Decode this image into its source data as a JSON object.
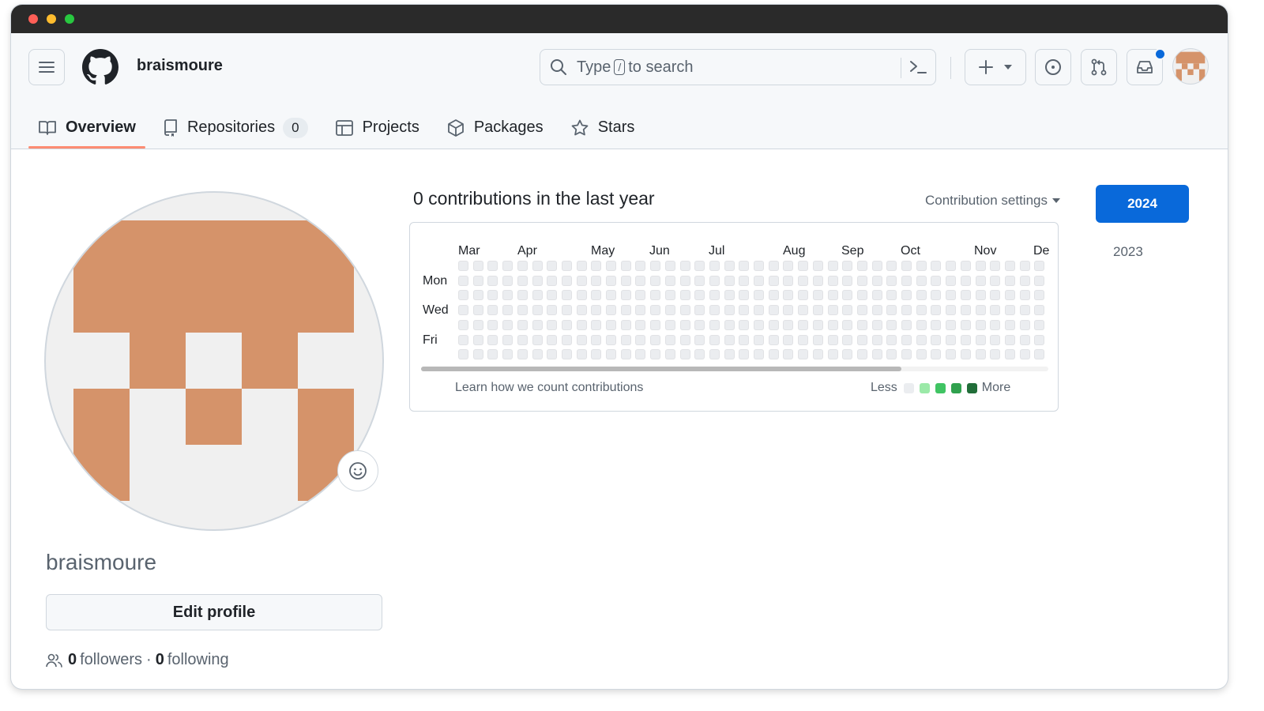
{
  "header": {
    "username": "braismoure",
    "search": {
      "prefix": "Type",
      "key": "/",
      "suffix": "to search"
    }
  },
  "tabs": [
    {
      "label": "Overview",
      "icon": "book-icon",
      "active": true
    },
    {
      "label": "Repositories",
      "icon": "repo-icon",
      "counter": "0"
    },
    {
      "label": "Projects",
      "icon": "table-icon"
    },
    {
      "label": "Packages",
      "icon": "package-icon"
    },
    {
      "label": "Stars",
      "icon": "star-icon"
    }
  ],
  "profile": {
    "name": "braismoure",
    "edit_label": "Edit profile",
    "followers_count": "0",
    "followers_label": "followers",
    "separator": "·",
    "following_count": "0",
    "following_label": "following"
  },
  "contributions": {
    "title": "0 contributions in the last year",
    "settings_label": "Contribution settings",
    "months": [
      "Mar",
      "Apr",
      "May",
      "Jun",
      "Jul",
      "Aug",
      "Sep",
      "Oct",
      "Nov",
      "De"
    ],
    "day_labels": [
      "Mon",
      "Wed",
      "Fri"
    ],
    "learn_label": "Learn how we count contributions",
    "legend_less": "Less",
    "legend_more": "More",
    "legend_colors": [
      "#ebedf0",
      "#9be9a8",
      "#40c463",
      "#30a14e",
      "#216e39"
    ],
    "cell_color": "#ebedf0"
  },
  "years": {
    "selected": "2024",
    "other": "2023"
  },
  "colors": {
    "accent": "#0969da",
    "tab_underline": "#fd8c73",
    "avatar": "#d5936a",
    "avatar_bg": "#f0f0f0"
  }
}
